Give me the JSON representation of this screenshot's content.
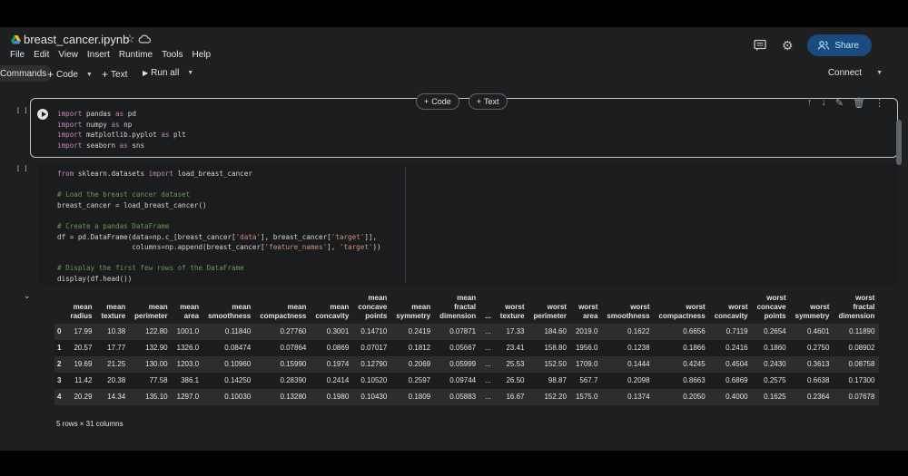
{
  "notebook": {
    "title": "breast_cancer.ipynb"
  },
  "menu": [
    "File",
    "Edit",
    "View",
    "Insert",
    "Runtime",
    "Tools",
    "Help"
  ],
  "header": {
    "share_label": "Share"
  },
  "toolbar": {
    "commands": "Commands",
    "code": "Code",
    "text": "Text",
    "run_all": "Run all",
    "connect": "Connect"
  },
  "insert": {
    "code": "Code",
    "text": "Text"
  },
  "cells": [
    {
      "exec": "[ ]"
    },
    {
      "exec": "[ ]"
    }
  ],
  "output": {
    "columns": [
      "mean\nradius",
      "mean\ntexture",
      "mean\nperimeter",
      "mean\narea",
      "mean\nsmoothness",
      "mean\ncompactness",
      "mean\nconcavity",
      "mean\nconcave\npoints",
      "mean\nsymmetry",
      "mean\nfractal\ndimension",
      "...",
      "worst\ntexture",
      "worst\nperimeter",
      "worst\narea",
      "worst\nsmoothness",
      "worst\ncompactness",
      "worst\nconcavity",
      "worst\nconcave\npoints",
      "worst\nsymmetry",
      "worst\nfractal\ndimension"
    ],
    "rows": [
      [
        "0",
        "17.99",
        "10.38",
        "122.80",
        "1001.0",
        "0.11840",
        "0.27760",
        "0.3001",
        "0.14710",
        "0.2419",
        "0.07871",
        "...",
        "17.33",
        "184.60",
        "2019.0",
        "0.1622",
        "0.6656",
        "0.7119",
        "0.2654",
        "0.4601",
        "0.11890"
      ],
      [
        "1",
        "20.57",
        "17.77",
        "132.90",
        "1326.0",
        "0.08474",
        "0.07864",
        "0.0869",
        "0.07017",
        "0.1812",
        "0.05667",
        "...",
        "23.41",
        "158.80",
        "1956.0",
        "0.1238",
        "0.1866",
        "0.2416",
        "0.1860",
        "0.2750",
        "0.08902"
      ],
      [
        "2",
        "19.69",
        "21.25",
        "130.00",
        "1203.0",
        "0.10960",
        "0.15990",
        "0.1974",
        "0.12790",
        "0.2069",
        "0.05999",
        "...",
        "25.53",
        "152.50",
        "1709.0",
        "0.1444",
        "0.4245",
        "0.4504",
        "0.2430",
        "0.3613",
        "0.08758"
      ],
      [
        "3",
        "11.42",
        "20.38",
        "77.58",
        "386.1",
        "0.14250",
        "0.28390",
        "0.2414",
        "0.10520",
        "0.2597",
        "0.09744",
        "...",
        "26.50",
        "98.87",
        "567.7",
        "0.2098",
        "0.8663",
        "0.6869",
        "0.2575",
        "0.6638",
        "0.17300"
      ],
      [
        "4",
        "20.29",
        "14.34",
        "135.10",
        "1297.0",
        "0.10030",
        "0.13280",
        "0.1980",
        "0.10430",
        "0.1809",
        "0.05883",
        "...",
        "16.67",
        "152.20",
        "1575.0",
        "0.1374",
        "0.2050",
        "0.4000",
        "0.1625",
        "0.2364",
        "0.07678"
      ]
    ],
    "shape": "5 rows × 31 columns"
  }
}
